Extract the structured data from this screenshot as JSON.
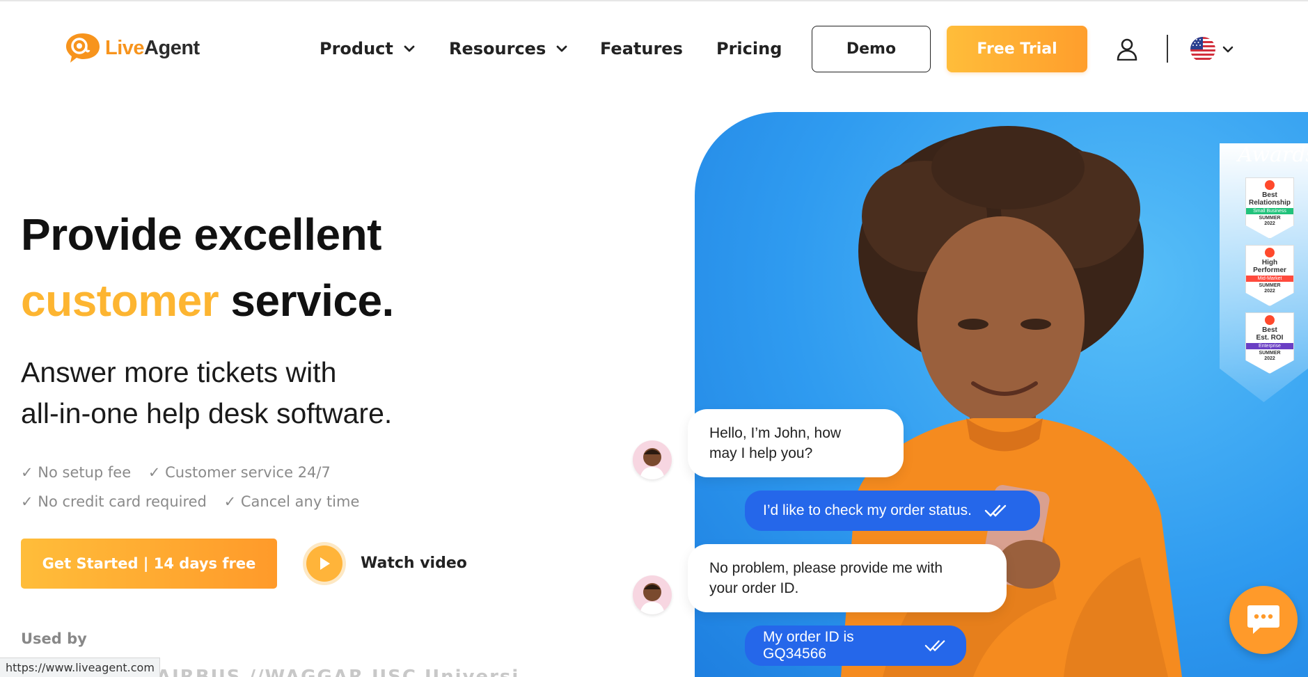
{
  "brand": {
    "logo_live": "Live",
    "logo_agent": "Agent"
  },
  "nav": {
    "items": [
      {
        "label": "Product",
        "has_dropdown": true
      },
      {
        "label": "Resources",
        "has_dropdown": true
      },
      {
        "label": "Features",
        "has_dropdown": false
      },
      {
        "label": "Pricing",
        "has_dropdown": false
      }
    ],
    "demo_label": "Demo",
    "trial_label": "Free Trial",
    "language_icon": "us-flag-icon"
  },
  "hero": {
    "headline_line1": "Provide excellent",
    "headline_orange": "customer",
    "headline_rest": " service.",
    "subhead_line1": "Answer more tickets with",
    "subhead_line2": "all-in-one help desk software.",
    "checks": [
      "✓ No setup fee",
      "✓ Customer service 24/7",
      "✓ No credit card required",
      "✓ Cancel any time"
    ],
    "cta_label": "Get Started | 14 days free",
    "watch_label": "Watch video",
    "used_by_label": "Used by",
    "used_by_logos_partial": "AIRBUS   //WAGGAR   USC University of"
  },
  "awards": {
    "title": "Awards",
    "badges": [
      {
        "line1": "Best",
        "line2": "Relationship",
        "strip": "Small Business",
        "strip_color": "#21c27b",
        "season_top": "SUMMER",
        "season_year": "2022"
      },
      {
        "line1": "High",
        "line2": "Performer",
        "strip": "Mid-Market",
        "strip_color": "#ff4a3d",
        "season_top": "SUMMER",
        "season_year": "2022"
      },
      {
        "line1": "Best",
        "line2": "Est. ROI",
        "strip": "Enterprise",
        "strip_color": "#6a3fc4",
        "season_top": "SUMMER",
        "season_year": "2022"
      }
    ]
  },
  "chat": {
    "agent_msg1_line1": "Hello, I’m John, how",
    "agent_msg1_line2": "may I help you?",
    "user_msg1": "I’d like to check my order status.",
    "agent_msg2_line1": "No problem, please provide me with",
    "agent_msg2_line2": "your order ID.",
    "user_msg2": "My order ID is GQ34566"
  },
  "status_url": "https://www.liveagent.com",
  "colors": {
    "accent_orange": "#ffb43a",
    "chat_blue": "#2567ea",
    "hero_blue": "#2f9bf0"
  }
}
